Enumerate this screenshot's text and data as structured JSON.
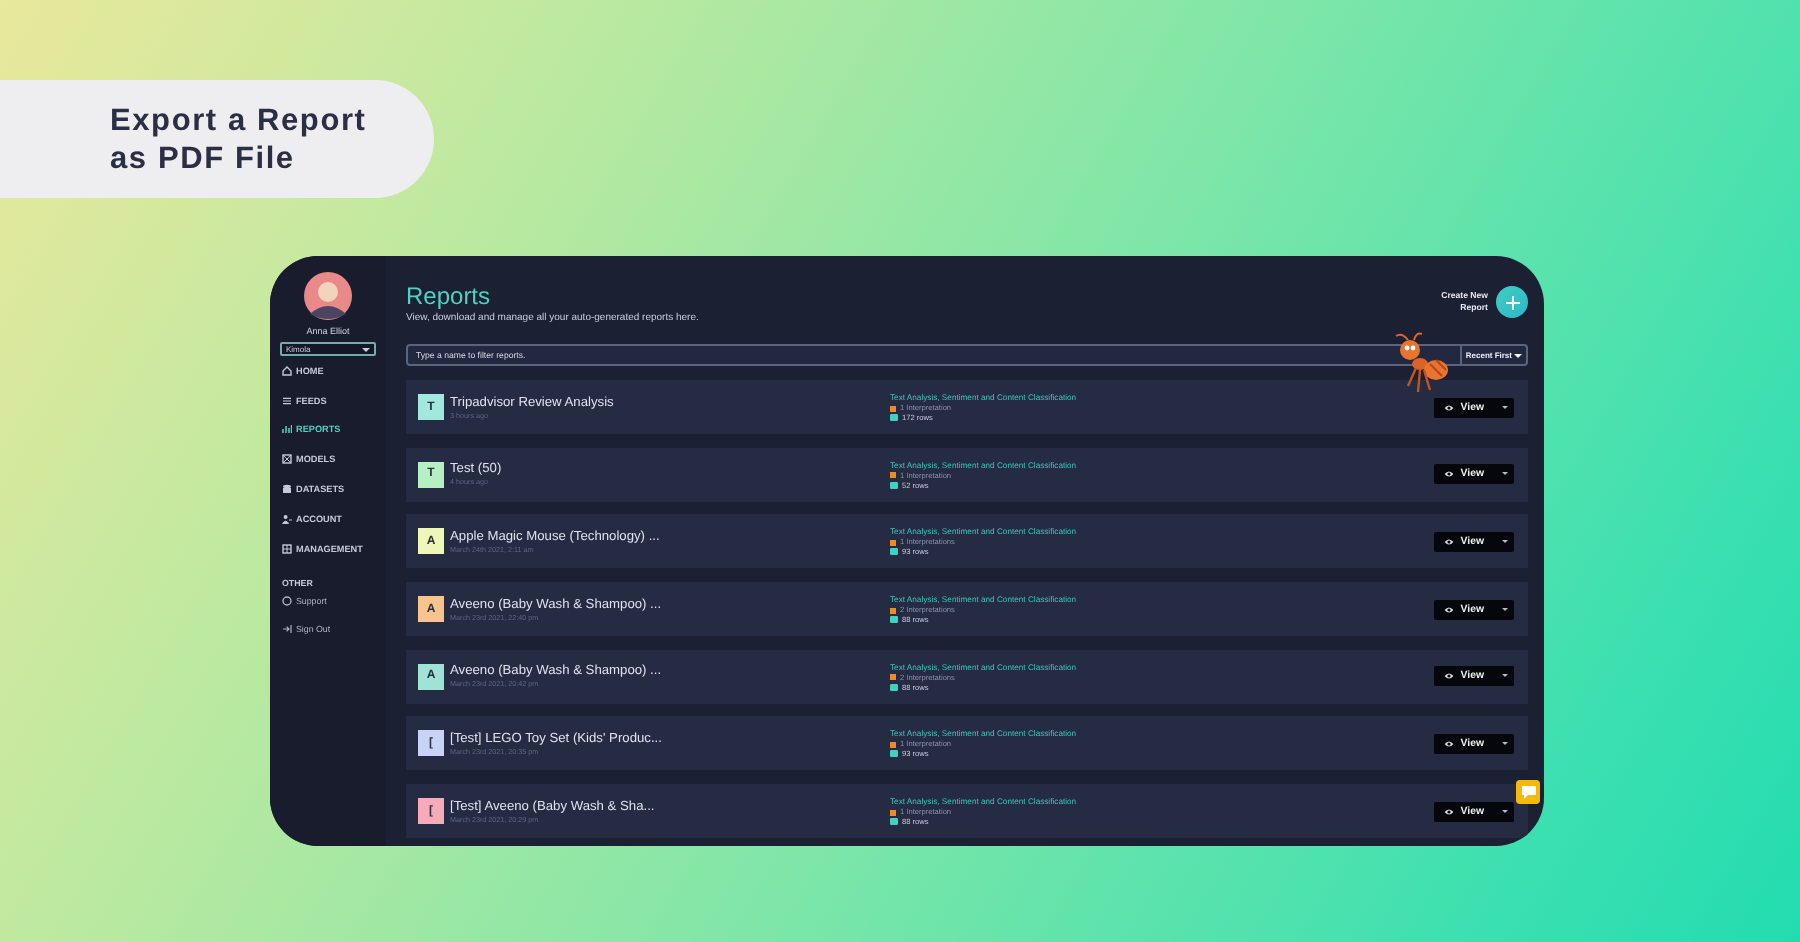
{
  "headline": "Export a Report as PDF File",
  "sidebar": {
    "user_name": "Anna Elliot",
    "workspace": "Kimola",
    "nav": [
      {
        "label": "HOME",
        "selected": false
      },
      {
        "label": "FEEDS",
        "selected": false
      },
      {
        "label": "REPORTS",
        "selected": true
      },
      {
        "label": "MODELS",
        "selected": false
      },
      {
        "label": "DATASETS",
        "selected": false
      },
      {
        "label": "ACCOUNT",
        "selected": false
      },
      {
        "label": "MANAGEMENT",
        "selected": false
      }
    ],
    "other_heading": "OTHER",
    "other_links": [
      "Support",
      "Sign Out"
    ]
  },
  "header": {
    "title": "Reports",
    "subtitle": "View, download and manage all your auto-generated reports here.",
    "create_button": "Create New Report"
  },
  "filter": {
    "placeholder": "Type a name to filter reports.",
    "sort": "Recent First"
  },
  "reports": [
    {
      "initial": "T",
      "color": "#a3e8dc",
      "title": "Tripadvisor Review Analysis",
      "time": "3 hours ago",
      "category": "Text Analysis, Sentiment and Content Classification",
      "interpretations": "1 Interpretation",
      "rows": "172 rows",
      "button": "View"
    },
    {
      "initial": "T",
      "color": "#b5efc2",
      "title": "Test (50)",
      "time": "4 hours ago",
      "category": "Text Analysis, Sentiment and Content Classification",
      "interpretations": "1 Interpretation",
      "rows": "52 rows",
      "button": "View"
    },
    {
      "initial": "A",
      "color": "#eef7b8",
      "title": "Apple Magic Mouse (Technology) ...",
      "time": "March 24th 2021, 2:11 am",
      "category": "Text Analysis, Sentiment and Content Classification",
      "interpretations": "1 Interpretations",
      "rows": "93 rows",
      "button": "View"
    },
    {
      "initial": "A",
      "color": "#f8c48e",
      "title": "Aveeno (Baby Wash & Shampoo) ...",
      "time": "March 23rd 2021, 22:40 pm",
      "category": "Text Analysis, Sentiment and Content Classification",
      "interpretations": "2 Interpretations",
      "rows": "88 rows",
      "button": "View"
    },
    {
      "initial": "A",
      "color": "#9fe3d6",
      "title": "Aveeno (Baby Wash & Shampoo) ...",
      "time": "March 23rd 2021, 20:42 pm",
      "category": "Text Analysis, Sentiment and Content Classification",
      "interpretations": "2 Interpretations",
      "rows": "88 rows",
      "button": "View"
    },
    {
      "initial": "[",
      "color": "#c9d3f8",
      "title": "[Test] LEGO Toy Set (Kids' Produc...",
      "time": "March 23rd 2021, 20:35 pm",
      "category": "Text Analysis, Sentiment and Content Classification",
      "interpretations": "1 Interpretation",
      "rows": "93 rows",
      "button": "View"
    },
    {
      "initial": "[",
      "color": "#f7aab8",
      "title": "[Test] Aveeno (Baby Wash & Sha...",
      "time": "March 23rd 2021, 20:29 pm",
      "category": "Text Analysis, Sentiment and Content Classification",
      "interpretations": "1 Interpretation",
      "rows": "88 rows",
      "button": "View"
    }
  ]
}
